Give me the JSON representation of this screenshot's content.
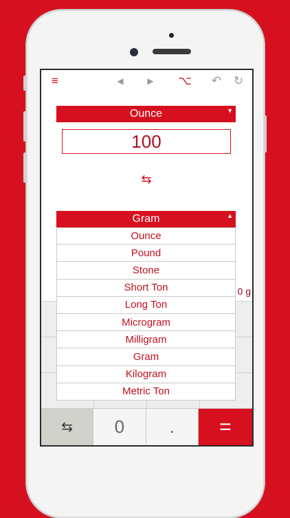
{
  "toolbar": {
    "menu_icon": "≡",
    "back_icon": "◀",
    "forward_icon": "▶",
    "option_icon": "⌥",
    "undo_icon": "↶",
    "redo_icon": "↻"
  },
  "from_unit": {
    "label": "Ounce",
    "arrow": "▼"
  },
  "input_value": "100",
  "swap_icon": "⇆",
  "result_partial": "0 g",
  "to_unit": {
    "label": "Gram",
    "arrow": "▲"
  },
  "dropdown_options": [
    "Ounce",
    "Pound",
    "Stone",
    "Short Ton",
    "Long Ton",
    "Microgram",
    "Milligram",
    "Gram",
    "Kilogram",
    "Metric Ton"
  ],
  "keypad_bottom": {
    "swap_icon": "⇆",
    "zero": "0",
    "decimal": ".",
    "equals": "="
  },
  "colors": {
    "accent": "#d7101f",
    "background": "#d7101f",
    "text_red": "#c0101e"
  }
}
